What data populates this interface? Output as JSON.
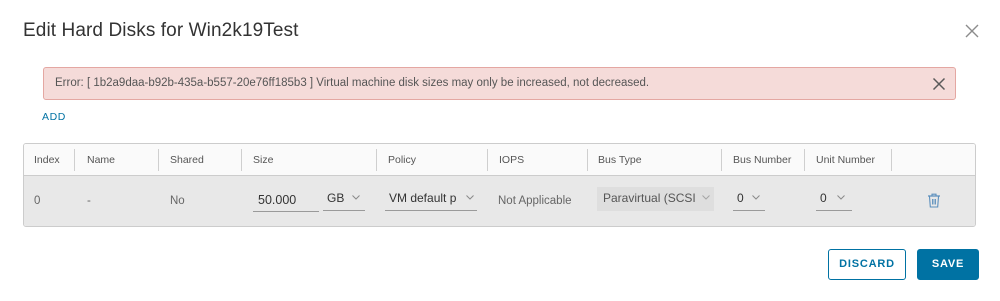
{
  "dialog": {
    "title": "Edit Hard Disks for Win2k19Test"
  },
  "error": {
    "message": "Error: [ 1b2a9daa-b92b-435a-b557-20e76ff185b3 ] Virtual machine disk sizes may only be increased, not decreased."
  },
  "actions": {
    "add_label": "ADD",
    "discard_label": "DISCARD",
    "save_label": "SAVE"
  },
  "grid": {
    "columns": [
      "Index",
      "Name",
      "Shared",
      "Size",
      "Policy",
      "IOPS",
      "Bus Type",
      "Bus Number",
      "Unit Number"
    ],
    "rows": [
      {
        "index": "0",
        "name": "-",
        "shared": "No",
        "size_value": "50.000",
        "size_unit": "GB",
        "policy": "VM default p",
        "iops": "Not Applicable",
        "bus_type": "Paravirtual (SCSI",
        "bus_number": "0",
        "unit_number": "0"
      }
    ]
  },
  "icons": {
    "close": "close-icon",
    "alert_close": "close-icon",
    "delete": "trash-icon",
    "dropdown": "chevron-down-icon"
  },
  "colors": {
    "accent": "#0072a3",
    "error_bg": "#f5dbd9",
    "error_border": "#e4a7a2",
    "row_bg": "#e8e8e8"
  }
}
